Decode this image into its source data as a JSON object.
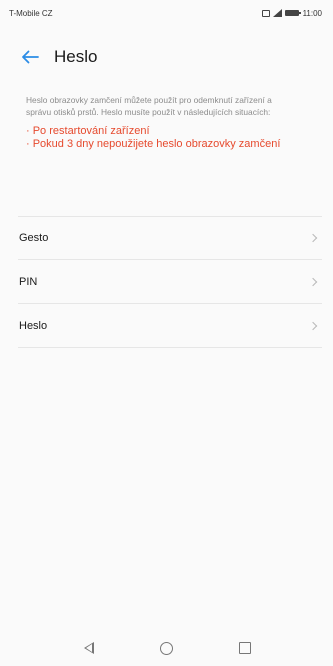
{
  "status_bar": {
    "carrier": "T-Mobile CZ",
    "time": "11:00"
  },
  "header": {
    "title": "Heslo",
    "back_icon": "arrow-left-icon",
    "accent_color": "#2b8ce6"
  },
  "info": {
    "text": "Heslo obrazovky zamčení můžete použít pro odemknutí zařízení a správu otisků prstů. Heslo musíte použít v následujících situacích:",
    "bullets": [
      "· Po restartování zařízení",
      "· Pokud 3 dny nepoužijete heslo obrazovky zamčení"
    ],
    "bullet_color": "#e64a2e"
  },
  "menu": {
    "items": [
      {
        "label": "Gesto",
        "icon": "chevron-right-icon"
      },
      {
        "label": "PIN",
        "icon": "chevron-right-icon"
      },
      {
        "label": "Heslo",
        "icon": "chevron-right-icon"
      }
    ]
  },
  "nav_bar": {
    "buttons": [
      "back-triangle-icon",
      "home-circle-icon",
      "recent-square-icon"
    ]
  }
}
